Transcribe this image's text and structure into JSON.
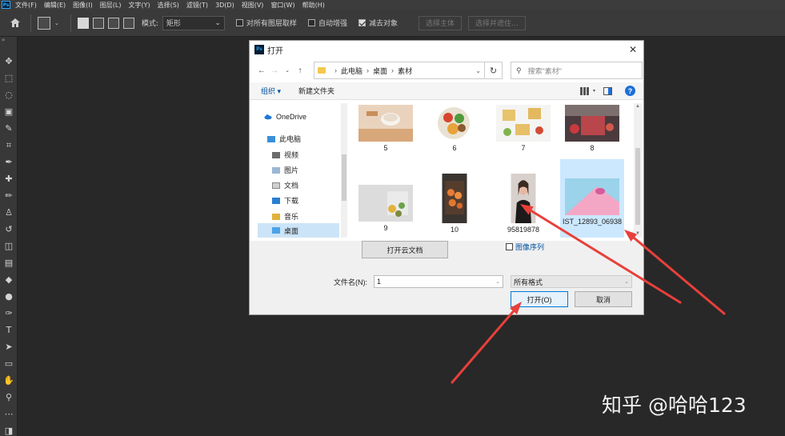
{
  "menubar": {
    "app_badge": "Ps",
    "items": [
      "文件(F)",
      "编辑(E)",
      "图像(I)",
      "图层(L)",
      "文字(Y)",
      "选择(S)",
      "滤镜(T)",
      "3D(D)",
      "视图(V)",
      "窗口(W)",
      "帮助(H)"
    ]
  },
  "options": {
    "mode_label": "模式:",
    "mode_value": "矩形",
    "sample_all_layers": "对所有图层取样",
    "auto_enhance": "自动增强",
    "subtract_object": "减去对象",
    "select_subject": "选择主体",
    "select_and_mask": "选择并遮住..."
  },
  "toolbar": {
    "tools": [
      {
        "name": "move-tool",
        "glyph": "✥"
      },
      {
        "name": "marquee-tool",
        "glyph": "⬚"
      },
      {
        "name": "lasso-tool",
        "glyph": "◌"
      },
      {
        "name": "object-selection-tool",
        "glyph": "▣"
      },
      {
        "name": "quick-selection-tool",
        "glyph": "✎"
      },
      {
        "name": "crop-tool",
        "glyph": "⌗"
      },
      {
        "name": "eyedropper-tool",
        "glyph": "✒"
      },
      {
        "name": "healing-brush-tool",
        "glyph": "✚"
      },
      {
        "name": "brush-tool",
        "glyph": "✏"
      },
      {
        "name": "clone-stamp-tool",
        "glyph": "♙"
      },
      {
        "name": "history-brush-tool",
        "glyph": "↺"
      },
      {
        "name": "eraser-tool",
        "glyph": "◫"
      },
      {
        "name": "gradient-tool",
        "glyph": "▤"
      },
      {
        "name": "blur-tool",
        "glyph": "◆"
      },
      {
        "name": "dodge-tool",
        "glyph": "●"
      },
      {
        "name": "pen-tool",
        "glyph": "✑"
      },
      {
        "name": "type-tool",
        "glyph": "T"
      },
      {
        "name": "path-selection-tool",
        "glyph": "➤"
      },
      {
        "name": "rectangle-tool",
        "glyph": "▭"
      },
      {
        "name": "hand-tool",
        "glyph": "✋"
      },
      {
        "name": "zoom-tool",
        "glyph": "⚲"
      },
      {
        "name": "more-tools",
        "glyph": "⋯"
      },
      {
        "name": "color-swatches",
        "glyph": "◨"
      }
    ]
  },
  "dialog": {
    "title": "打开",
    "breadcrumb": [
      "此电脑",
      "桌面",
      "素材"
    ],
    "search_placeholder": "搜索\"素材\"",
    "organize": "组织 ▾",
    "new_folder": "新建文件夹",
    "nav": {
      "onedrive": "OneDrive",
      "this_pc": "此电脑",
      "videos": "视频",
      "pictures": "图片",
      "documents": "文档",
      "downloads": "下载",
      "music": "音乐",
      "desktop": "桌面"
    },
    "files": [
      {
        "label": "5"
      },
      {
        "label": "6"
      },
      {
        "label": "7"
      },
      {
        "label": "8"
      },
      {
        "label": "9"
      },
      {
        "label": "10"
      },
      {
        "label": "95819878"
      },
      {
        "label": "IST_12893_06938"
      }
    ],
    "open_cloud": "打开云文档",
    "image_sequence": "图像序列",
    "filename_label": "文件名(N):",
    "filename_value": "1",
    "filetype_value": "所有格式",
    "open_button": "打开(O)",
    "cancel_button": "取消"
  },
  "colors": {
    "annotation_arrow": "#e8403a",
    "selection": "#cce8ff"
  },
  "watermark": "知乎 @哈哈123"
}
